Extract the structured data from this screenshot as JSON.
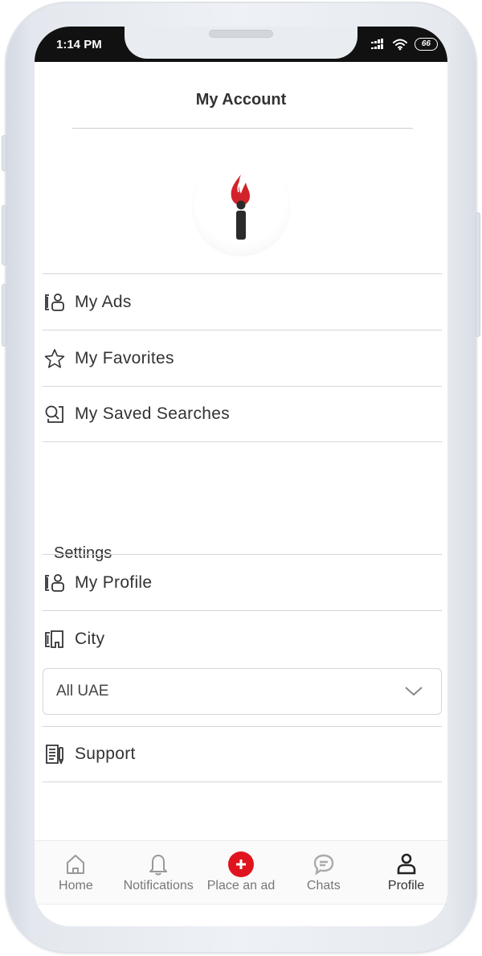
{
  "status_bar": {
    "time": "1:14 PM",
    "battery": "66"
  },
  "header": {
    "title": "My Account"
  },
  "menu": {
    "items": [
      {
        "label": "My Ads",
        "icon": "ads-profile-icon"
      },
      {
        "label": "My Favorites",
        "icon": "star-icon"
      },
      {
        "label": "My Saved Searches",
        "icon": "saved-search-icon"
      }
    ]
  },
  "settings": {
    "heading": "Settings",
    "items": [
      {
        "label": "My Profile",
        "icon": "profile-card-icon"
      },
      {
        "label": "City",
        "icon": "city-icon"
      }
    ],
    "city_select": {
      "value": "All UAE"
    },
    "support": {
      "label": "Support",
      "icon": "support-document-icon"
    }
  },
  "tabbar": {
    "tabs": [
      {
        "label": "Home",
        "icon": "home-icon"
      },
      {
        "label": "Notifications",
        "icon": "bell-icon"
      },
      {
        "label": "Place an ad",
        "icon": "plus-circle-icon"
      },
      {
        "label": "Chats",
        "icon": "chat-icon"
      },
      {
        "label": "Profile",
        "icon": "person-icon",
        "active": true
      }
    ]
  },
  "colors": {
    "accent": "#e0141e",
    "text": "#333333",
    "divider": "#d6d6d6"
  }
}
